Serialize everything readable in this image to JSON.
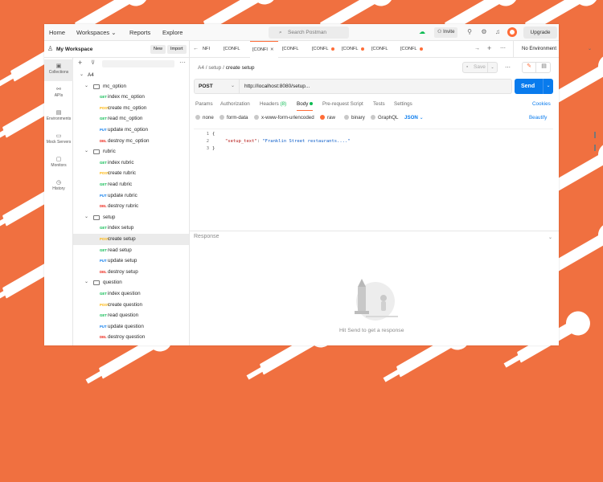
{
  "topbar": {
    "nav": [
      "Home",
      "Workspaces",
      "Reports",
      "Explore"
    ],
    "search_placeholder": "Search Postman",
    "invite_label": "Invite",
    "upgrade_label": "Upgrade"
  },
  "workspace": {
    "title": "My Workspace",
    "new_label": "New",
    "import_label": "Import"
  },
  "rail": [
    {
      "label": "Collections",
      "icon": "collections-icon"
    },
    {
      "label": "APIs",
      "icon": "apis-icon"
    },
    {
      "label": "Environments",
      "icon": "environments-icon"
    },
    {
      "label": "Mock Servers",
      "icon": "mock-servers-icon"
    },
    {
      "label": "Monitors",
      "icon": "monitors-icon"
    },
    {
      "label": "History",
      "icon": "history-icon"
    }
  ],
  "tree": {
    "collection": "A4",
    "folders": [
      {
        "name": "mc_option",
        "requests": [
          {
            "method": "GET",
            "name": "index mc_option"
          },
          {
            "method": "POST",
            "name": "create mc_option"
          },
          {
            "method": "GET",
            "name": "read mc_option"
          },
          {
            "method": "PUT",
            "name": "update mc_option"
          },
          {
            "method": "DEL",
            "name": "destroy mc_option"
          }
        ]
      },
      {
        "name": "rubric",
        "requests": [
          {
            "method": "GET",
            "name": "index rubric"
          },
          {
            "method": "POST",
            "name": "create rubric"
          },
          {
            "method": "GET",
            "name": "read rubric"
          },
          {
            "method": "PUT",
            "name": "update rubric"
          },
          {
            "method": "DEL",
            "name": "destroy rubric"
          }
        ]
      },
      {
        "name": "setup",
        "requests": [
          {
            "method": "GET",
            "name": "index setup"
          },
          {
            "method": "POST",
            "name": "create setup",
            "selected": true
          },
          {
            "method": "GET",
            "name": "read setup"
          },
          {
            "method": "PUT",
            "name": "update setup"
          },
          {
            "method": "DEL",
            "name": "destroy setup"
          }
        ]
      },
      {
        "name": "question",
        "requests": [
          {
            "method": "GET",
            "name": "index question"
          },
          {
            "method": "POST",
            "name": "create question"
          },
          {
            "method": "GET",
            "name": "read question"
          },
          {
            "method": "PUT",
            "name": "update question"
          },
          {
            "method": "DEL",
            "name": "destroy question"
          }
        ]
      }
    ]
  },
  "tabs": {
    "items": [
      {
        "label": "NFI",
        "method": ""
      },
      {
        "label": "[CONFL",
        "method": ""
      },
      {
        "label": "[CONFI",
        "method": "",
        "active": true
      },
      {
        "label": "[CONFL",
        "method": ""
      },
      {
        "label": "[CONFL",
        "method": "",
        "dot": true
      },
      {
        "label": "[CONFL",
        "method": "",
        "dot": true
      },
      {
        "label": "[CONFL",
        "method": ""
      },
      {
        "label": "[CONFL",
        "method": "",
        "dot": true
      }
    ],
    "environment": "No Environment"
  },
  "request": {
    "breadcrumb": [
      "A4",
      "setup"
    ],
    "name": "create setup",
    "save_label": "Save",
    "method": "POST",
    "url": "http://localhost:8080/setup...",
    "send_label": "Send",
    "subtabs": [
      "Params",
      "Authorization",
      "Headers",
      "(8)",
      "Body",
      "Pre-request Script",
      "Tests",
      "Settings"
    ],
    "cookies_label": "Cookies",
    "body_options": [
      "none",
      "form-data",
      "x-www-form-urlencoded",
      "raw",
      "binary",
      "GraphQL"
    ],
    "body_format": "JSON",
    "beautify_label": "Beautify",
    "code_lines": [
      "1",
      "2",
      "3"
    ],
    "code": {
      "open": "{",
      "key": "\"setup_text\"",
      "sep": ": ",
      "value": "\"Franklin Street restaurants....\"",
      "close": "}"
    }
  },
  "response": {
    "title": "Response",
    "hint": "Hit Send to get a response"
  },
  "colors": {
    "accent": "#ff6c37",
    "send": "#097bed",
    "background": "#f07040"
  }
}
